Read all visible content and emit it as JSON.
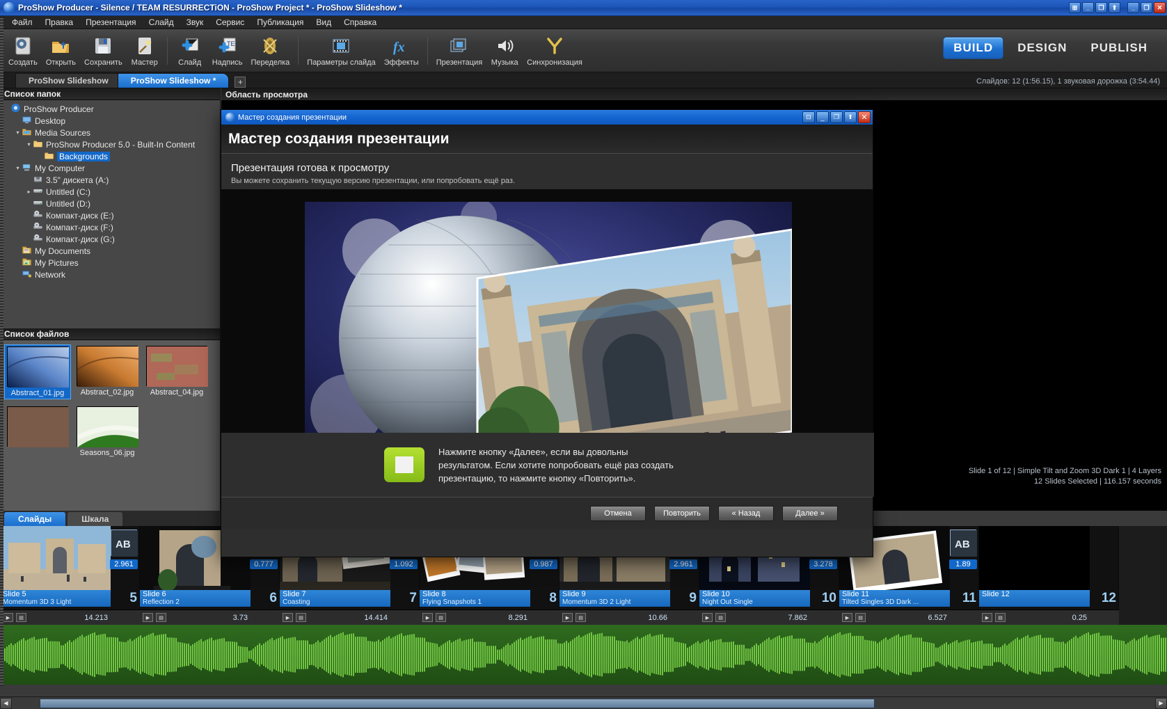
{
  "window": {
    "title": "ProShow Producer - Silence / TEAM RESURRECTiON - ProShow Project * - ProShow Slideshow *",
    "buttons": {
      "restore_group": "⊞",
      "minimize": "_",
      "maximize": "❐",
      "restore": "⬆",
      "close": "✕"
    }
  },
  "menu": {
    "items": [
      "Файл",
      "Правка",
      "Презентация",
      "Слайд",
      "Звук",
      "Сервис",
      "Публикация",
      "Вид",
      "Справка"
    ]
  },
  "toolbar": {
    "groups": [
      {
        "items": [
          {
            "label": "Создать",
            "icon": "new-project-icon"
          },
          {
            "label": "Открыть",
            "icon": "open-folder-icon"
          },
          {
            "label": "Сохранить",
            "icon": "save-disk-icon"
          },
          {
            "label": "Мастер",
            "icon": "wizard-wand-icon"
          }
        ]
      },
      {
        "items": [
          {
            "label": "Слайд",
            "icon": "add-slide-icon"
          },
          {
            "label": "Надпись",
            "icon": "add-caption-icon"
          },
          {
            "label": "Переделка",
            "icon": "remix-icon"
          }
        ]
      },
      {
        "items": [
          {
            "label": "Параметры слайда",
            "icon": "slide-options-icon"
          },
          {
            "label": "Эффекты",
            "icon": "effects-fx-icon"
          }
        ]
      },
      {
        "items": [
          {
            "label": "Презентация",
            "icon": "show-options-icon"
          },
          {
            "label": "Музыка",
            "icon": "music-speaker-icon"
          },
          {
            "label": "Синхронизация",
            "icon": "sync-icon"
          }
        ]
      }
    ],
    "modes": [
      {
        "label": "BUILD",
        "active": true
      },
      {
        "label": "DESIGN",
        "active": false
      },
      {
        "label": "PUBLISH",
        "active": false
      }
    ],
    "accent_color": "#1d6fd0"
  },
  "tabs": {
    "items": [
      {
        "label": "ProShow Slideshow",
        "active": false
      },
      {
        "label": "ProShow Slideshow *",
        "active": true
      }
    ],
    "add_label": "+",
    "status": "Слайдов: 12 (1:56.15), 1 звуковая дорожка (3:54.44)"
  },
  "folder_panel": {
    "title": "Список папок",
    "items": [
      {
        "label": "ProShow Producer",
        "indent": 0,
        "icon": "app-icon",
        "expander": "",
        "selected": false
      },
      {
        "label": "Desktop",
        "indent": 1,
        "icon": "desktop-icon",
        "expander": "",
        "selected": false
      },
      {
        "label": "Media Sources",
        "indent": 1,
        "icon": "media-folder-icon",
        "expander": "▾",
        "selected": false
      },
      {
        "label": "ProShow Producer 5.0 - Built-In Content",
        "indent": 2,
        "icon": "folder-icon",
        "expander": "▾",
        "selected": false
      },
      {
        "label": "Backgrounds",
        "indent": 3,
        "icon": "folder-icon",
        "expander": "",
        "selected": true
      },
      {
        "label": "My Computer",
        "indent": 1,
        "icon": "computer-icon",
        "expander": "▾",
        "selected": false
      },
      {
        "label": "3.5\" дискета (A:)",
        "indent": 2,
        "icon": "floppy-icon",
        "expander": "",
        "selected": false
      },
      {
        "label": "Untitled (C:)",
        "indent": 2,
        "icon": "harddisk-icon",
        "expander": "▸",
        "selected": false
      },
      {
        "label": "Untitled (D:)",
        "indent": 2,
        "icon": "harddisk-icon",
        "expander": "",
        "selected": false
      },
      {
        "label": "Компакт-диск (E:)",
        "indent": 2,
        "icon": "cdrom-icon",
        "expander": "",
        "selected": false
      },
      {
        "label": "Компакт-диск (F:)",
        "indent": 2,
        "icon": "cdrom-icon",
        "expander": "",
        "selected": false
      },
      {
        "label": "Компакт-диск (G:)",
        "indent": 2,
        "icon": "cdrom-icon",
        "expander": "",
        "selected": false
      },
      {
        "label": "My Documents",
        "indent": 1,
        "icon": "documents-icon",
        "expander": "",
        "selected": false
      },
      {
        "label": "My Pictures",
        "indent": 1,
        "icon": "pictures-icon",
        "expander": "",
        "selected": false
      },
      {
        "label": "Network",
        "indent": 1,
        "icon": "network-icon",
        "expander": "",
        "selected": false
      }
    ]
  },
  "file_panel": {
    "title": "Список файлов",
    "files": [
      {
        "name": "Abstract_01.jpg",
        "selected": true,
        "thumb": "blue-abstract"
      },
      {
        "name": "Abstract_02.jpg",
        "selected": false,
        "thumb": "orange-abstract"
      },
      {
        "name": "Abstract_04.jpg",
        "selected": false,
        "thumb": "red-green-abstract"
      },
      {
        "name": "",
        "selected": false,
        "thumb": "clipped-abstract"
      },
      {
        "name": "Seasons_06.jpg",
        "selected": false,
        "thumb": "green-leaf"
      }
    ]
  },
  "preview_panel": {
    "title": "Область просмотра",
    "slide_info_line1": "Slide 1 of 12  |  Simple Tilt and Zoom 3D Dark 1  |  4 Layers",
    "slide_info_line2": "12 Slides Selected  |  116.157 seconds"
  },
  "bottom_tabs": [
    {
      "label": "Слайды",
      "active": true
    },
    {
      "label": "Шкала",
      "active": false
    }
  ],
  "filmstrip": {
    "slides": [
      {
        "number": "5",
        "title": "Slide 5",
        "subtitle": "Momentum 3D 3 Light",
        "duration": "14.213",
        "transition": "2.961",
        "badge": "AB",
        "thumb": "registan-day"
      },
      {
        "number": "6",
        "title": "Slide 6",
        "subtitle": "Reflection 2",
        "duration": "3.73",
        "transition": "0.777",
        "badge": "drop",
        "thumb": "registan-arch"
      },
      {
        "number": "7",
        "title": "Slide 7",
        "subtitle": "Coasting",
        "duration": "14.414",
        "transition": "1.092",
        "badge": "bars",
        "thumb": "registan-wide"
      },
      {
        "number": "8",
        "title": "Slide 8",
        "subtitle": "Flying Snapshots 1",
        "duration": "8.291",
        "transition": "0.987",
        "badge": "arrows",
        "thumb": "snapshots"
      },
      {
        "number": "9",
        "title": "Slide 9",
        "subtitle": "Momentum 3D 2 Light",
        "duration": "10.66",
        "transition": "2.961",
        "badge": "comb",
        "thumb": "registan-dusk"
      },
      {
        "number": "10",
        "title": "Slide 10",
        "subtitle": "Night Out Single",
        "duration": "7.862",
        "transition": "3.278",
        "badge": "comb2",
        "thumb": "registan-night"
      },
      {
        "number": "11",
        "title": "Slide 11",
        "subtitle": "Tilted Singles 3D Dark ...",
        "duration": "6.527",
        "transition": "1.89",
        "badge": "AB",
        "thumb": "registan-tilt"
      },
      {
        "number": "12",
        "title": "Slide 12",
        "subtitle": "",
        "duration": "0.25",
        "transition": "",
        "badge": "",
        "thumb": "black"
      }
    ],
    "play_glyph": "▶"
  },
  "dialog": {
    "titlebar": "Мастер создания презентации",
    "heading": "Мастер создания презентации",
    "subtitle": "Презентация готова к просмотру",
    "description": "Вы можете сохранить текущую версию презентации, или попробовать ещё раз.",
    "note_lines": [
      "Нажмите кнопку «Далее», если вы довольны",
      "результатом. Если хотите попробовать ещё раз создать",
      "презентацию, то нажмите кнопку «Повторить»."
    ],
    "note_color": "#a8d427",
    "buttons": [
      {
        "label": "Отмена"
      },
      {
        "label": "Повторить"
      },
      {
        "label": "« Назад"
      },
      {
        "label": "Далее »"
      }
    ],
    "window_buttons": {
      "pin": "⊡",
      "minimize": "_",
      "maximize": "❐",
      "up": "⬆",
      "close": "✕"
    }
  }
}
